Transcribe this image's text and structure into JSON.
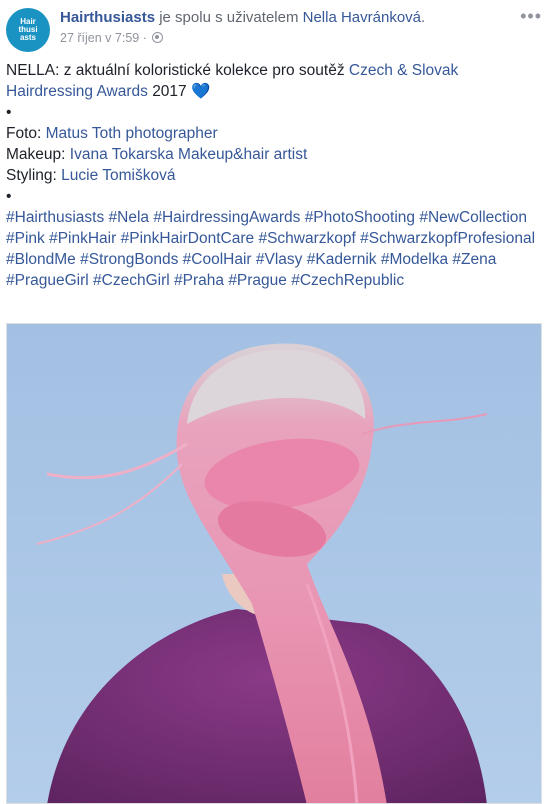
{
  "post": {
    "avatar_text": "Hair thusi asts",
    "page_name": "Hairthusiasts",
    "with_text": "je spolu s uživatelem",
    "tagged_user": "Nella Havránková",
    "period": ".",
    "timestamp": "27 říjen v 7:59",
    "separator": "·",
    "more_label": "•••",
    "line1_prefix": "NELLA: z aktuální koloristické kolekce pro soutěž",
    "line1_link": "Czech & Slovak",
    "line2_link": "Hairdressing Awards",
    "line2_suffix": "2017",
    "heart": "💙",
    "bullet1": "•",
    "foto_label": "Foto:",
    "foto_link": "Matus Toth photographer",
    "makeup_label": "Makeup:",
    "makeup_link": "Ivana Tokarska Makeup&hair artist",
    "styling_label": "Styling:",
    "styling_link": "Lucie Tomišková",
    "bullet2": "•",
    "hashtags": [
      "#Hairthusiasts",
      "#Nela",
      "#HairdressingAwards",
      "#PhotoShooting",
      "#NewCollection",
      "#Pink",
      "#PinkHair",
      "#PinkHairDontCare",
      "#Schwarzkopf",
      "#SchwarzkopfProfesional",
      "#BlondMe",
      "#StrongBonds",
      "#CoolHair",
      "#Vlasy",
      "#Kadernik",
      "#Modelka",
      "#Zena",
      "#PragueGirl",
      "#CzechGirl",
      "#Praha",
      "#Prague",
      "#CzechRepublic"
    ]
  }
}
